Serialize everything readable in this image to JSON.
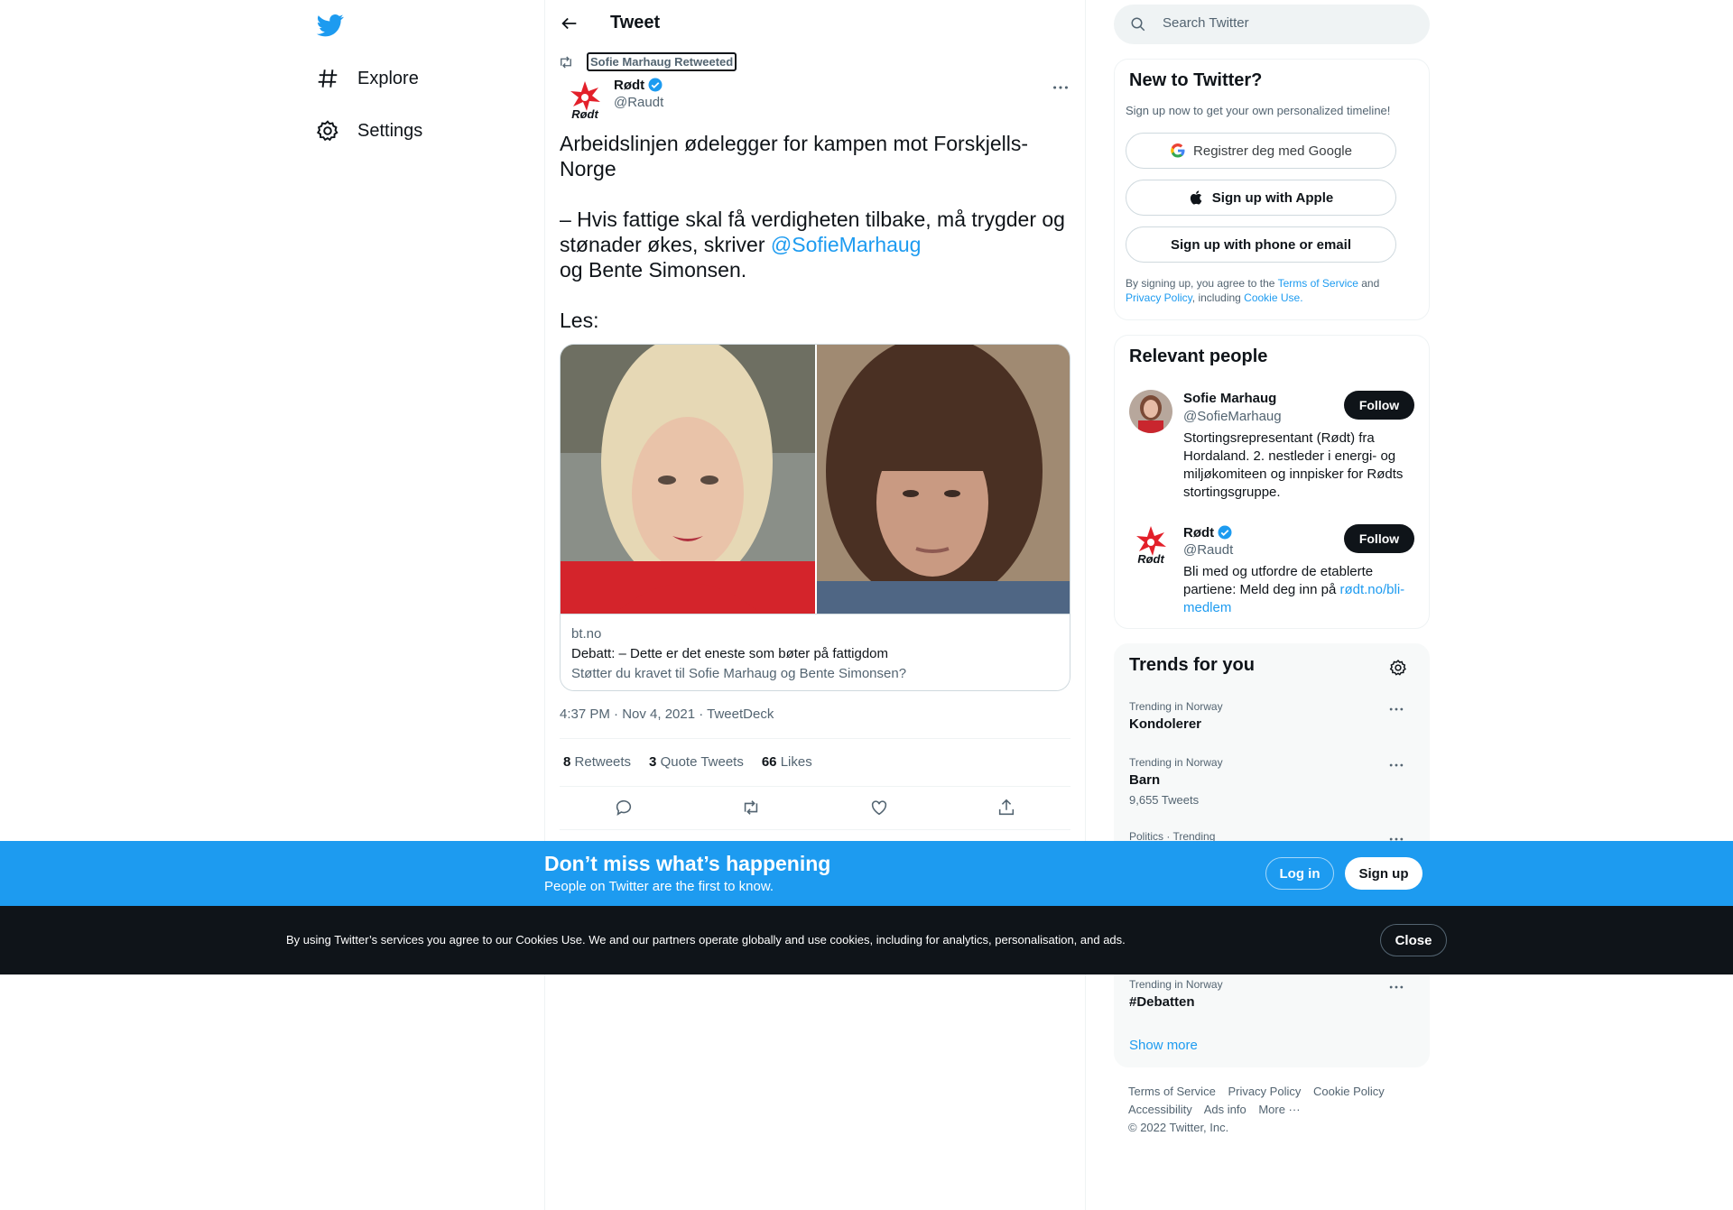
{
  "nav": {
    "logo": "twitter-bird-icon",
    "items": [
      {
        "label": "Explore",
        "icon": "hashtag-icon"
      },
      {
        "label": "Settings",
        "icon": "gear-icon"
      }
    ]
  },
  "header": {
    "title": "Tweet",
    "back_icon": "arrow-left-icon"
  },
  "tweet": {
    "retweeted_by": "Sofie Marhaug Retweeted",
    "author_name": "Rødt",
    "author_handle": "@Raudt",
    "text_part1": "Arbeidslinjen ødelegger for kampen mot Forskjells-Norge\n\n– Hvis fattige skal få verdigheten tilbake, må trygder og stønader økes, skriver ",
    "mention": "@SofieMarhaug",
    "text_part2": "\nog Bente Simonsen.\n\nLes:",
    "card": {
      "domain": "bt.no",
      "title": "Debatt: – Dette er det eneste som bøter på fattigdom",
      "description": "Støtter du kravet til Sofie Marhaug og Bente Simonsen?"
    },
    "timestamp": "4:37 PM · Nov 4, 2021 · TweetDeck",
    "stats": [
      {
        "count": "8",
        "label": "Retweets"
      },
      {
        "count": "3",
        "label": "Quote Tweets"
      },
      {
        "count": "66",
        "label": "Likes"
      }
    ]
  },
  "search": {
    "placeholder": "Search Twitter"
  },
  "new_to_twitter": {
    "title": "New to Twitter?",
    "subtitle": "Sign up now to get your own personalized timeline!",
    "google_label": "Registrer deg med Google",
    "apple_label": "Sign up with Apple",
    "phone_label": "Sign up with phone or email",
    "legal_prefix": "By signing up, you agree to the ",
    "terms": "Terms of Service",
    "and": " and ",
    "privacy": "Privacy Policy",
    "including": ", including ",
    "cookie": "Cookie Use."
  },
  "relevant_people": {
    "title": "Relevant people",
    "people": [
      {
        "name": "Sofie Marhaug",
        "handle": "@SofieMarhaug",
        "bio": "Stortingsrepresentant (Rødt) fra Hordaland. 2. nestleder i energi- og miljøkomiteen og innpisker for Rødts stortingsgruppe.",
        "follow": "Follow"
      },
      {
        "name": "Rødt",
        "handle": "@Raudt",
        "bio_prefix": "Bli med og utfordre de etablerte partiene: Meld deg inn på ",
        "bio_link": "rødt.no/bli-medlem",
        "follow": "Follow"
      }
    ]
  },
  "trends": {
    "title": "Trends for you",
    "items": [
      {
        "context": "Trending in Norway",
        "name": "Kondolerer",
        "count": ""
      },
      {
        "context": "Trending in Norway",
        "name": "Barn",
        "count": "9,655 Tweets"
      },
      {
        "context": "Politics · Trending",
        "name": "",
        "count": ""
      },
      {
        "context": "Trending in Norway",
        "name": "#Debatten",
        "count": ""
      }
    ],
    "show_more": "Show more"
  },
  "footer": {
    "links": [
      "Terms of Service",
      "Privacy Policy",
      "Cookie Policy",
      "Accessibility",
      "Ads info",
      "More ···"
    ],
    "copyright": "© 2022 Twitter, Inc."
  },
  "banner": {
    "title": "Don’t miss what’s happening",
    "subtitle": "People on Twitter are the first to know.",
    "login": "Log in",
    "signup": "Sign up"
  },
  "cookie_bar": {
    "text": "By using Twitter’s services you agree to our Cookies Use. We and our partners operate globally and use cookies, including for analytics, personalisation, and ads.",
    "close": "Close"
  },
  "colors": {
    "accent": "#1d9bf0",
    "text": "#0f1419",
    "muted": "#536471",
    "rodt_red": "#e3202a"
  }
}
